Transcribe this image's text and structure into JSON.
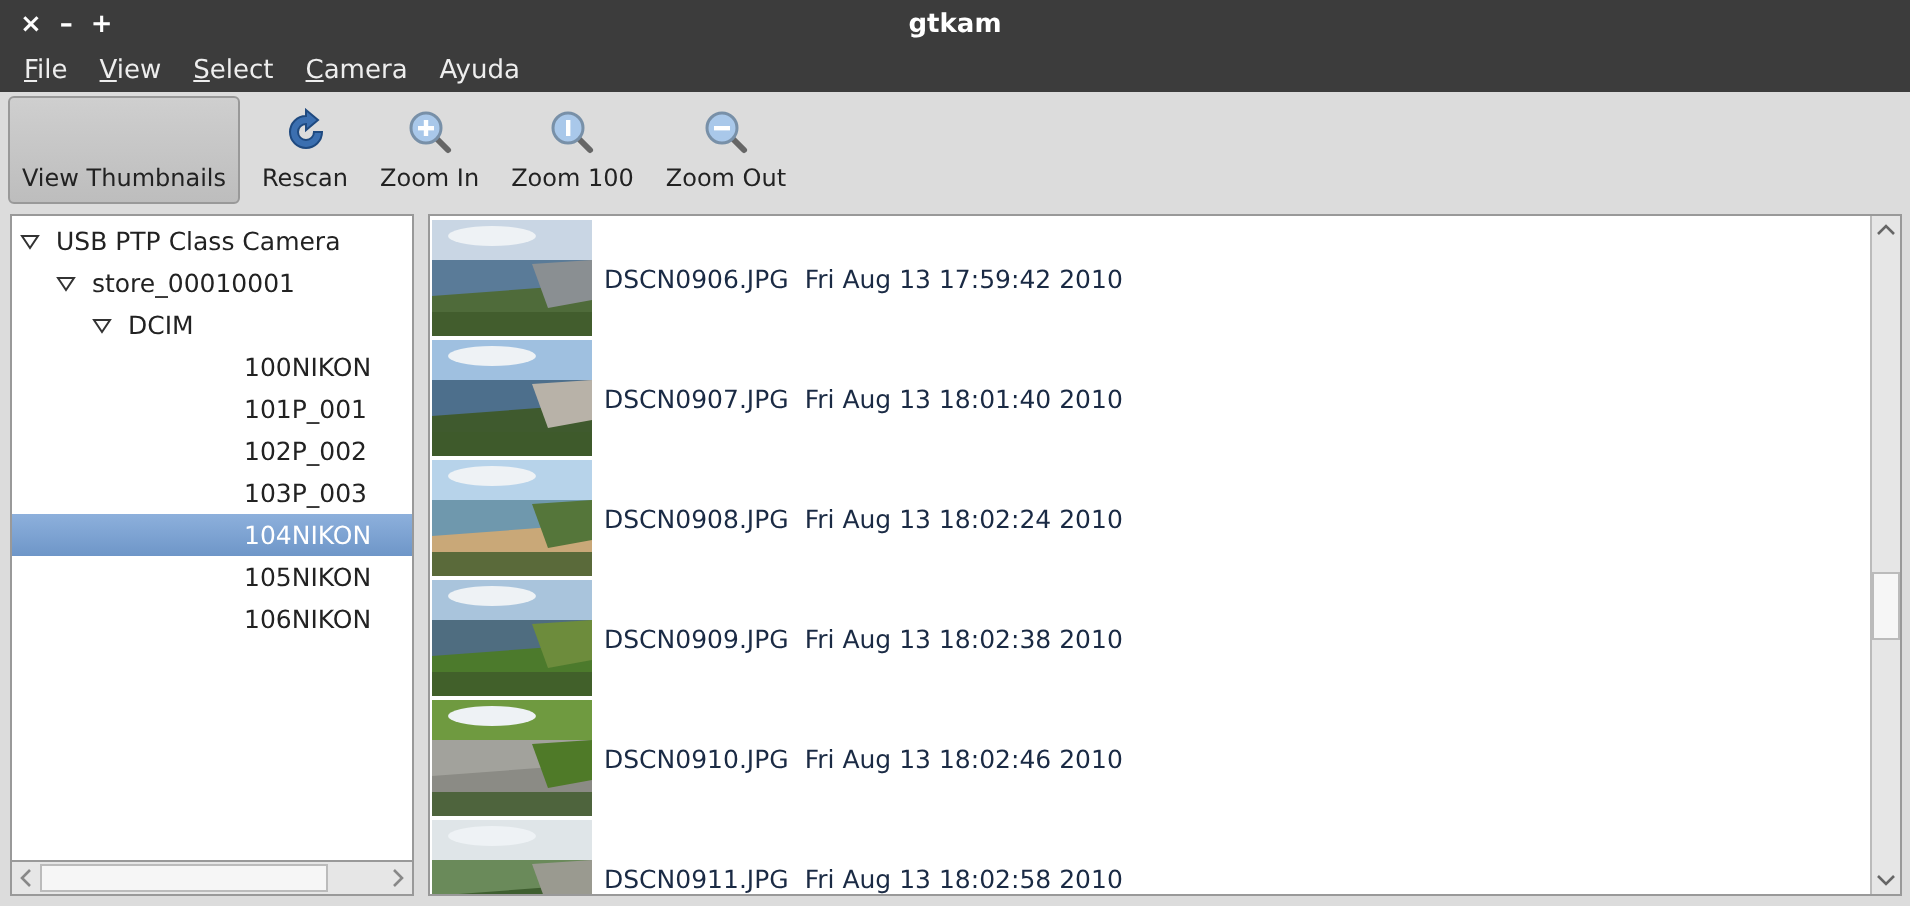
{
  "window": {
    "title": "gtkam",
    "controls": [
      "×",
      "–",
      "+"
    ]
  },
  "menu": [
    {
      "label": "File",
      "mnemonic": true
    },
    {
      "label": "View",
      "mnemonic": true
    },
    {
      "label": "Select",
      "mnemonic": true
    },
    {
      "label": "Camera",
      "mnemonic": true
    },
    {
      "label": "Ayuda",
      "mnemonic": false
    }
  ],
  "toolbar": [
    {
      "label": "View Thumbnails",
      "kind": "toggle",
      "selected": true
    },
    {
      "label": "Rescan",
      "kind": "rescan",
      "selected": false
    },
    {
      "label": "Zoom In",
      "kind": "zoom-in",
      "selected": false
    },
    {
      "label": "Zoom 100",
      "kind": "zoom-100",
      "selected": false
    },
    {
      "label": "Zoom Out",
      "kind": "zoom-out",
      "selected": false
    }
  ],
  "tree": [
    {
      "label": "USB PTP Class Camera",
      "expanded": true,
      "selected": false,
      "children": [
        {
          "label": "store_00010001",
          "expanded": true,
          "selected": false,
          "children": [
            {
              "label": "DCIM",
              "expanded": true,
              "selected": false,
              "children": [
                {
                  "label": "100NIKON",
                  "selected": false
                },
                {
                  "label": "101P_001",
                  "selected": false
                },
                {
                  "label": "102P_002",
                  "selected": false
                },
                {
                  "label": "103P_003",
                  "selected": false
                },
                {
                  "label": "104NIKON",
                  "selected": true
                },
                {
                  "label": "105NIKON",
                  "selected": false
                },
                {
                  "label": "106NIKON",
                  "selected": false
                }
              ]
            }
          ]
        }
      ]
    }
  ],
  "files": [
    {
      "name": "DSCN0906.JPG",
      "date": "Fri Aug 13 17:59:42 2010"
    },
    {
      "name": "DSCN0907.JPG",
      "date": "Fri Aug 13 18:01:40 2010"
    },
    {
      "name": "DSCN0908.JPG",
      "date": "Fri Aug 13 18:02:24 2010"
    },
    {
      "name": "DSCN0909.JPG",
      "date": "Fri Aug 13 18:02:38 2010"
    },
    {
      "name": "DSCN0910.JPG",
      "date": "Fri Aug 13 18:02:46 2010"
    },
    {
      "name": "DSCN0911.JPG",
      "date": "Fri Aug 13 18:02:58 2010"
    }
  ]
}
